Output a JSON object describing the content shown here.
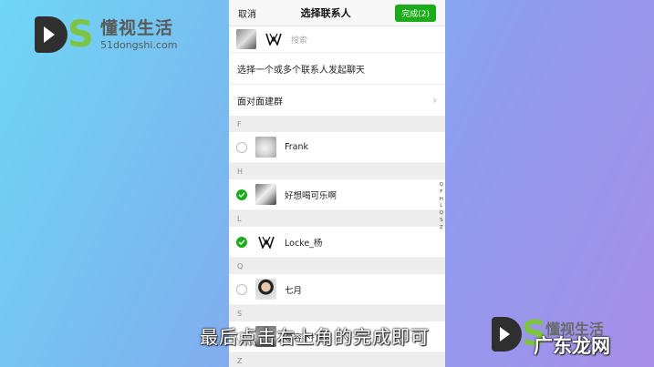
{
  "watermark": {
    "cn": "懂视生活",
    "url": "51dongshi.com"
  },
  "navbar": {
    "cancel": "取消",
    "title": "选择联系人",
    "done": "完成(2)"
  },
  "search": {
    "placeholder": "搜索"
  },
  "prompt": "选择一个或多个联系人发起聊天",
  "face_group": "面对面建群",
  "sections": [
    {
      "letter": "F",
      "contacts": [
        {
          "name": "Frank",
          "checked": false,
          "avatar": "frank-avatar"
        }
      ]
    },
    {
      "letter": "H",
      "contacts": [
        {
          "name": "好想喝可乐啊",
          "checked": true,
          "avatar": "bird-avatar"
        }
      ]
    },
    {
      "letter": "L",
      "contacts": [
        {
          "name": "Locke_杨",
          "checked": true,
          "avatar": "locke-logo-avatar"
        }
      ]
    },
    {
      "letter": "Q",
      "contacts": [
        {
          "name": "七月",
          "checked": false,
          "avatar": "person-avatar"
        }
      ]
    },
    {
      "letter": "S",
      "contacts": [
        {
          "name": "慕容不打折",
          "checked": false,
          "avatar": "mu-avatar"
        }
      ]
    },
    {
      "letter": "Z",
      "contacts": []
    }
  ],
  "index_letters": [
    "Q",
    "F",
    "H",
    "L",
    "Q",
    "S",
    "Z"
  ],
  "subtitle": "最后点击右上角的完成即可",
  "brand": {
    "cn": "懂视生活",
    "site": "广东龙网"
  },
  "colors": {
    "accent": "#1aad19"
  }
}
